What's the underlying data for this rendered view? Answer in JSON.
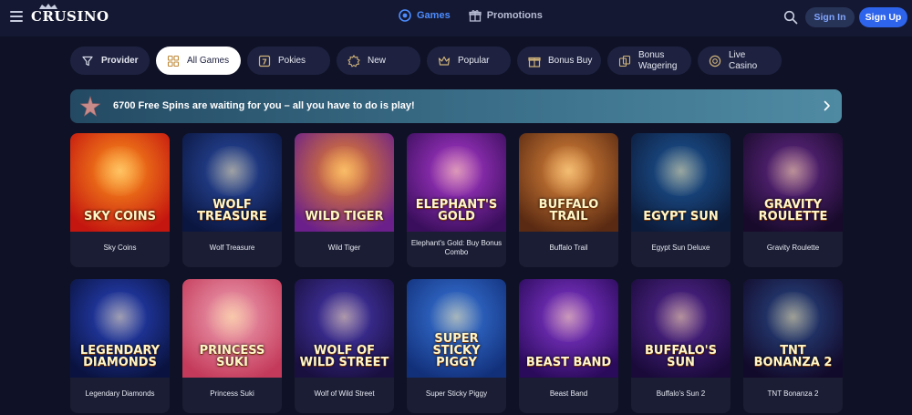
{
  "header": {
    "logo_text": "CRUSINO",
    "nav": [
      {
        "label": "Games",
        "icon": "games-icon",
        "active": true
      },
      {
        "label": "Promotions",
        "icon": "gift-icon",
        "active": false
      }
    ],
    "signin_label": "Sign In",
    "signup_label": "Sign Up"
  },
  "filters": [
    {
      "label": "Provider",
      "icon": "filter-icon"
    },
    {
      "label": "All Games",
      "icon": "grid-icon",
      "active": true
    },
    {
      "label": "Pokies",
      "icon": "slot-icon"
    },
    {
      "label": "New",
      "icon": "new-icon"
    },
    {
      "label": "Popular",
      "icon": "crown-icon"
    },
    {
      "label": "Bonus Buy",
      "icon": "gift-icon"
    },
    {
      "label": "Bonus Wagering",
      "icon": "wagering-icon"
    },
    {
      "label": "Live Casino",
      "icon": "live-casino-icon"
    }
  ],
  "banner": {
    "text": "6700 Free Spins are waiting for you – all you have to do is play!"
  },
  "games": [
    {
      "name": "Sky Coins",
      "art": "SKY COINS",
      "colors": [
        "#ff9a1c",
        "#c4150f"
      ]
    },
    {
      "name": "Wolf Treasure",
      "art": "WOLF TREASURE",
      "colors": [
        "#2b4ea8",
        "#0b1640"
      ]
    },
    {
      "name": "Wild Tiger",
      "art": "WILD TIGER",
      "colors": [
        "#f28a25",
        "#6a1f8a"
      ]
    },
    {
      "name": "Elephant's Gold: Buy Bonus Combo",
      "art": "ELEPHANT'S GOLD",
      "colors": [
        "#b23bd6",
        "#3a0e5c"
      ]
    },
    {
      "name": "Buffalo Trail",
      "art": "BUFFALO TRAIL",
      "colors": [
        "#e58b3d",
        "#5a2a12"
      ]
    },
    {
      "name": "Egypt Sun Deluxe",
      "art": "EGYPT SUN",
      "colors": [
        "#1e5a9e",
        "#0c1b3a"
      ]
    },
    {
      "name": "Gravity Roulette",
      "art": "GRAVITY ROULETTE",
      "colors": [
        "#6a2a8e",
        "#170a2a"
      ]
    },
    {
      "name": "Legendary Diamonds",
      "art": "LEGENDARY DIAMONDS",
      "colors": [
        "#2a46c8",
        "#0a1340"
      ]
    },
    {
      "name": "Princess Suki",
      "art": "PRINCESS SUKI",
      "colors": [
        "#f0a5b8",
        "#c43a5a"
      ]
    },
    {
      "name": "Wolf of Wild Street",
      "art": "WOLF OF WILD STREET",
      "colors": [
        "#4a3ab8",
        "#1a1040"
      ]
    },
    {
      "name": "Super Sticky Piggy",
      "art": "SUPER STICKY PIGGY",
      "colors": [
        "#3a7ae0",
        "#12307a"
      ]
    },
    {
      "name": "Beast Band",
      "art": "BEAST BAND",
      "colors": [
        "#8a3ad8",
        "#2a0a5a"
      ]
    },
    {
      "name": "Buffalo's Sun 2",
      "art": "BUFFALO'S SUN",
      "colors": [
        "#5a2a9a",
        "#1a0a3a"
      ]
    },
    {
      "name": "TNT Bonanza 2",
      "art": "TNT BONANZA 2",
      "colors": [
        "#2a4a8a",
        "#120a2a"
      ]
    }
  ]
}
